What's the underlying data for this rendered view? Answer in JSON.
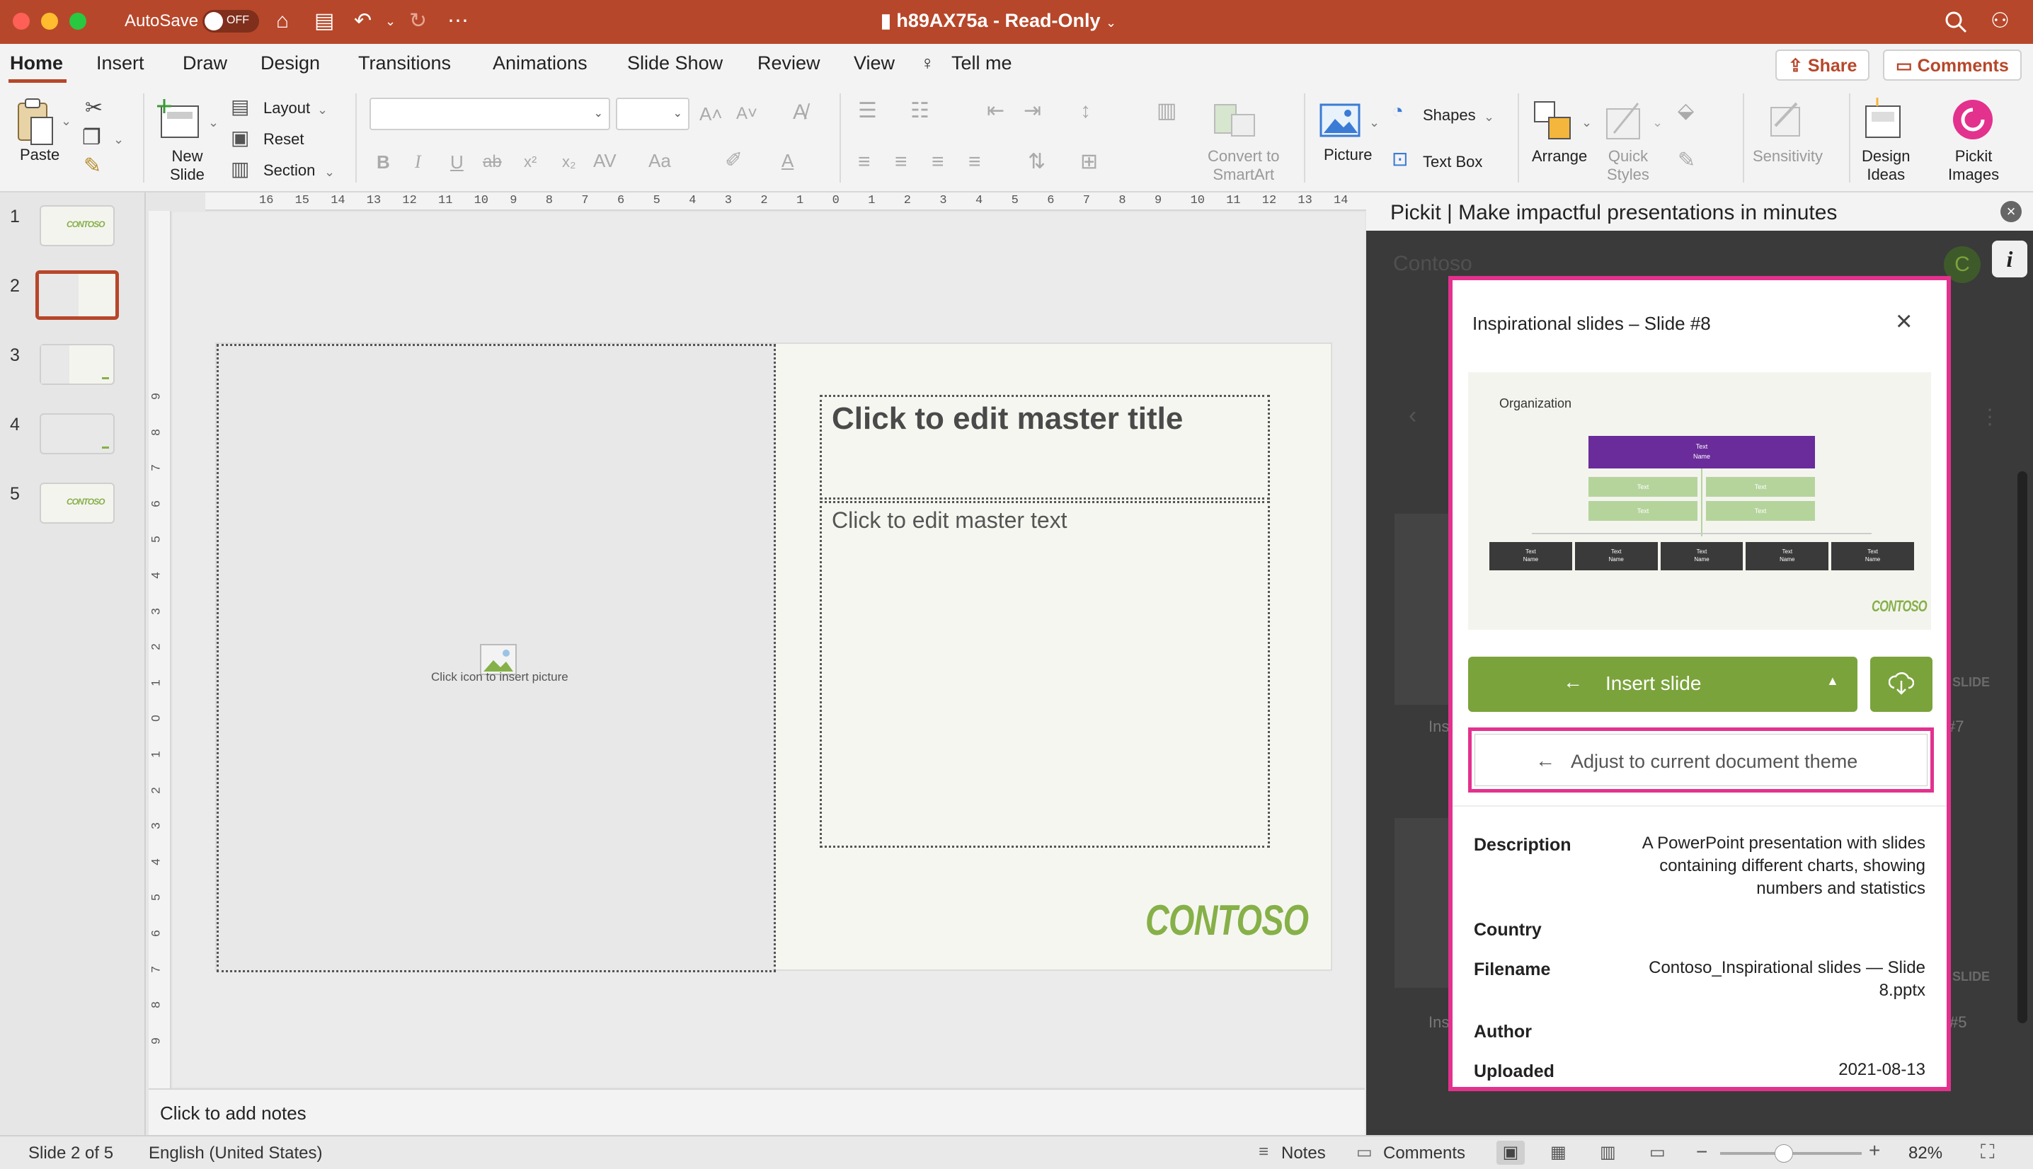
{
  "titlebar": {
    "autosave_label": "AutoSave",
    "autosave_state": "OFF",
    "filename": "h89AX75a",
    "mode": "Read-Only",
    "more": "⋯"
  },
  "tabs": [
    "Home",
    "Insert",
    "Draw",
    "Design",
    "Transitions",
    "Animations",
    "Slide Show",
    "Review",
    "View",
    "Tell me"
  ],
  "actions": {
    "share": "Share",
    "comments": "Comments"
  },
  "ribbon": {
    "paste": "Paste",
    "new_slide": "New\nSlide",
    "layout": "Layout",
    "reset": "Reset",
    "section": "Section",
    "font_name": "",
    "font_size": "",
    "convert_smartart": "Convert to\nSmartArt",
    "picture": "Picture",
    "shapes": "Shapes",
    "text_box": "Text Box",
    "arrange": "Arrange",
    "quick_styles": "Quick\nStyles",
    "sensitivity": "Sensitivity",
    "design_ideas": "Design\nIdeas",
    "pickit_images": "Pickit\nImages",
    "bold": "B",
    "italic": "I",
    "underline": "U",
    "strike": "ab",
    "superscript": "x²",
    "subscript": "x₂"
  },
  "slides": [
    {
      "num": "1",
      "thumb_text": "CONTOSO"
    },
    {
      "num": "2",
      "thumb_text": ""
    },
    {
      "num": "3",
      "thumb_text": ""
    },
    {
      "num": "4",
      "thumb_text": ""
    },
    {
      "num": "5",
      "thumb_text": "CONTOSO"
    }
  ],
  "ruler_ticks": [
    "16",
    "15",
    "14",
    "13",
    "12",
    "11",
    "10",
    "9",
    "8",
    "7",
    "6",
    "5",
    "4",
    "3",
    "2",
    "1",
    "0",
    "1",
    "2",
    "3",
    "4",
    "5",
    "6",
    "7",
    "8",
    "9",
    "10",
    "11",
    "12",
    "13",
    "14",
    "15",
    "16"
  ],
  "ruler_v_ticks": [
    "9",
    "8",
    "7",
    "6",
    "5",
    "4",
    "3",
    "2",
    "1",
    "0",
    "1",
    "2",
    "3",
    "4",
    "5",
    "6",
    "7",
    "8",
    "9"
  ],
  "slide": {
    "picture_hint": "Click icon to insert picture",
    "title": "Click to edit master title",
    "body": "Click to edit master text",
    "logo": "CONTOSO"
  },
  "notes_placeholder": "Click to add notes",
  "status": {
    "slide_counter": "Slide 2 of 5",
    "language": "English (United States)",
    "notes": "Notes",
    "comments": "Comments",
    "zoom": "82%",
    "zoom_level": 0.45
  },
  "pickit": {
    "header": "Pickit | Make impactful presentations in minutes",
    "brand": "Contoso",
    "avatar": "C",
    "info": "i",
    "bg_labels": [
      "Ins",
      "Ins",
      "#7",
      "#5",
      "SLIDE",
      "SLIDE"
    ],
    "modal": {
      "title": "Inspirational slides – Slide #8",
      "preview": {
        "heading": "Organization",
        "top_box": [
          "Text",
          "Name"
        ],
        "mid_box": "Text",
        "bottom_box": [
          "Text",
          "Name"
        ],
        "logo": "CONTOSO"
      },
      "insert_label": "Insert slide",
      "adjust_label": "Adjust to current document theme",
      "meta": [
        {
          "key": "Description",
          "value": "A PowerPoint presentation with slides containing different charts, showing numbers and statistics"
        },
        {
          "key": "Country",
          "value": ""
        },
        {
          "key": "Filename",
          "value": "Contoso_Inspirational slides — Slide 8.pptx"
        },
        {
          "key": "Author",
          "value": ""
        },
        {
          "key": "Uploaded",
          "value": "2021-08-13"
        }
      ]
    }
  },
  "colors": {
    "accent": "#b7472a",
    "green": "#7aa33b",
    "pink": "#e3318e",
    "purple": "#6a2c9a"
  }
}
